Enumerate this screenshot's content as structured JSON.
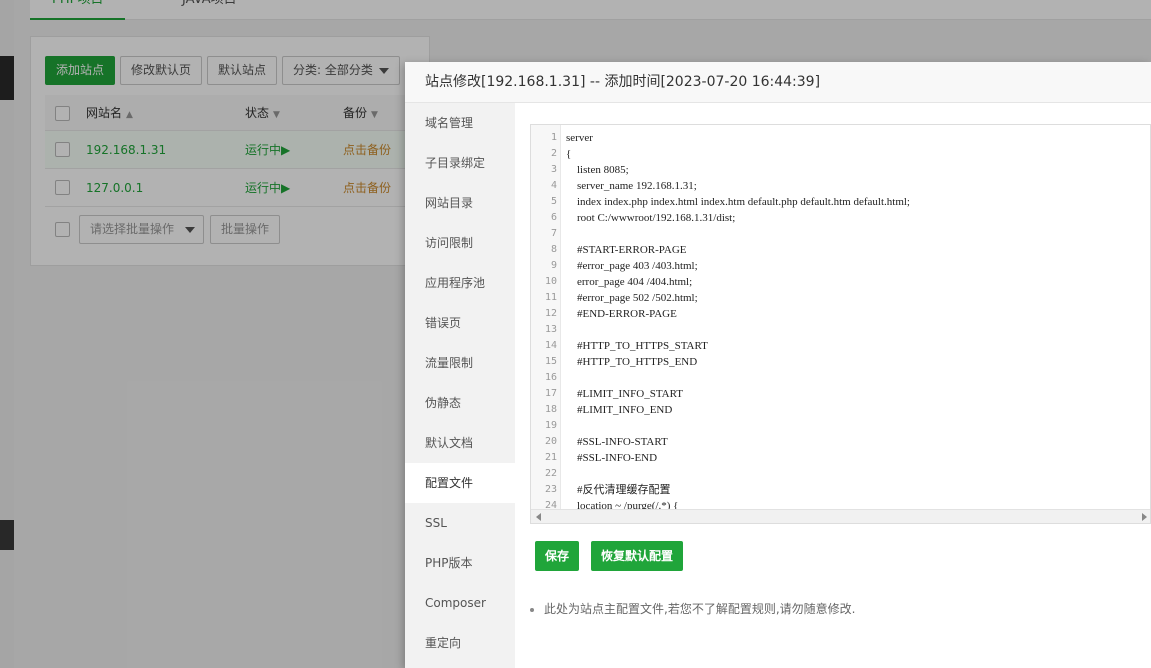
{
  "tabs": [
    {
      "label": "PHP项目"
    },
    {
      "label": "JAVA项目"
    }
  ],
  "toolbar": {
    "add_site": "添加站点",
    "edit_default_page": "修改默认页",
    "default_site": "默认站点",
    "category_filter": "分类: 全部分类"
  },
  "table": {
    "headers": {
      "name": "网站名",
      "status": "状态",
      "backup": "备份"
    },
    "rows": [
      {
        "name": "192.168.1.31",
        "status": "运行中",
        "backup": "点击备份"
      },
      {
        "name": "127.0.0.1",
        "status": "运行中",
        "backup": "点击备份"
      }
    ]
  },
  "bulk": {
    "select_placeholder": "请选择批量操作",
    "apply": "批量操作"
  },
  "modal": {
    "title": "站点修改[192.168.1.31] -- 添加时间[2023-07-20 16:44:39]",
    "sidebar": [
      "域名管理",
      "子目录绑定",
      "网站目录",
      "访问限制",
      "应用程序池",
      "错误页",
      "流量限制",
      "伪静态",
      "默认文档",
      "配置文件",
      "SSL",
      "PHP版本",
      "Composer",
      "重定向"
    ],
    "active_index": 9,
    "code_lines": [
      "server",
      "{",
      "    listen 8085;",
      "    server_name 192.168.1.31;",
      "    index index.php index.html index.htm default.php default.htm default.html;",
      "    root C:/wwwroot/192.168.1.31/dist;",
      "",
      "    #START-ERROR-PAGE",
      "    #error_page 403 /403.html;",
      "    error_page 404 /404.html;",
      "    #error_page 502 /502.html;",
      "    #END-ERROR-PAGE",
      "",
      "    #HTTP_TO_HTTPS_START",
      "    #HTTP_TO_HTTPS_END",
      "",
      "    #LIMIT_INFO_START",
      "    #LIMIT_INFO_END",
      "",
      "    #SSL-INFO-START",
      "    #SSL-INFO-END",
      "",
      "    #反代清理缓存配置",
      "    location ~ /purge(/.*) {"
    ],
    "save_button": "保存",
    "restore_button": "恢复默认配置",
    "tip": "此处为站点主配置文件,若您不了解配置规则,请勿随意修改."
  }
}
